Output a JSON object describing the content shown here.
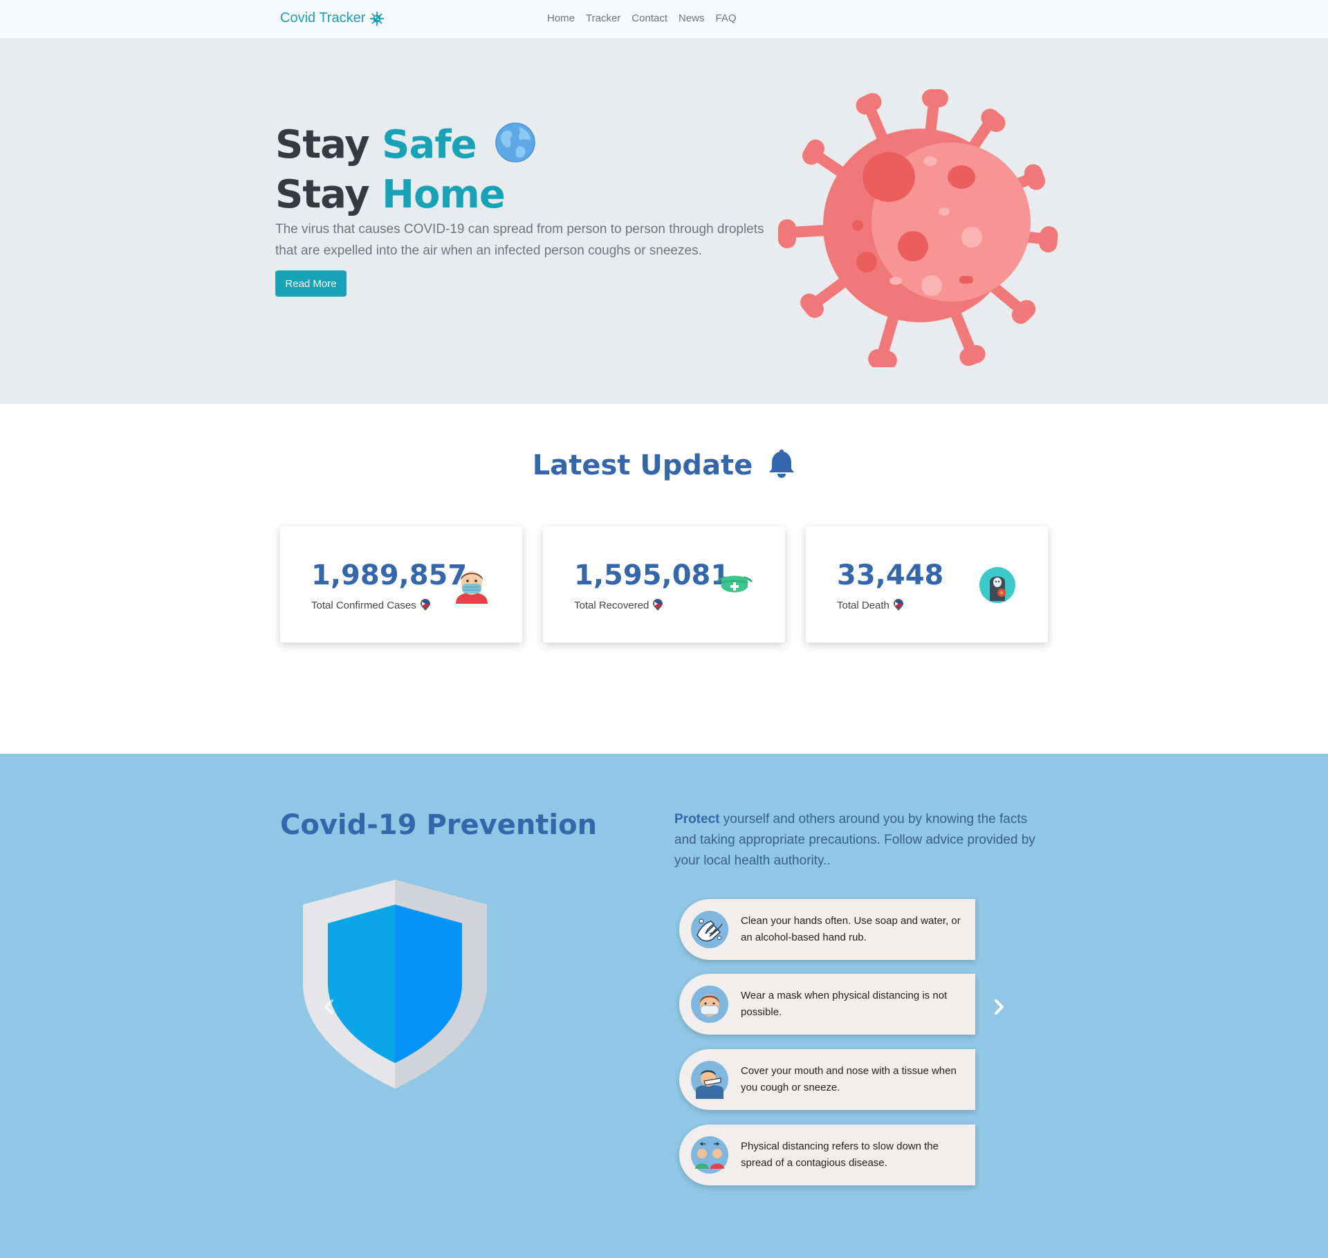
{
  "navbar": {
    "brand": "Covid Tracker",
    "links": [
      "Home",
      "Tracker",
      "Contact",
      "News",
      "FAQ"
    ]
  },
  "hero": {
    "line1_word1": "Stay",
    "line1_word2": "Safe",
    "line2_word1": "Stay",
    "line2_word2": "Home",
    "text": "The virus that causes COVID-19 can spread from person to person through droplets that are expelled into the air when an infected person coughs or sneezes.",
    "button": "Read More"
  },
  "latest": {
    "title": "Latest Update",
    "cards": [
      {
        "value": "1,989,857",
        "label": "Total Confirmed Cases",
        "icon": "masked-person-icon"
      },
      {
        "value": "1,595,081",
        "label": "Total Recovered",
        "icon": "medical-mask-icon"
      },
      {
        "value": "33,448",
        "label": "Total Death",
        "icon": "grim-reaper-icon"
      }
    ]
  },
  "prevention": {
    "title": "Covid-19 Prevention",
    "intro_bold": "Protect",
    "intro_rest": " yourself and others around you by knowing the facts and taking appropriate precautions. Follow advice provided by your local health authority..",
    "tips": [
      {
        "text": "Clean your hands often. Use soap and water, or an alcohol-based hand rub.",
        "icon": "hand-washing-icon"
      },
      {
        "text": "Wear a mask when physical distancing is not possible.",
        "icon": "mask-person-icon"
      },
      {
        "text": "Cover your mouth and nose with a tissue when you cough or sneeze.",
        "icon": "sneeze-icon"
      },
      {
        "text": "Physical distancing refers to slow down the spread of a contagious disease.",
        "icon": "distancing-icon"
      }
    ]
  },
  "colors": {
    "accent": "#17a2b8",
    "heading_blue": "#3366aa",
    "hero_bg": "#e9ecef",
    "prevention_bg": "#8fc7e4"
  }
}
